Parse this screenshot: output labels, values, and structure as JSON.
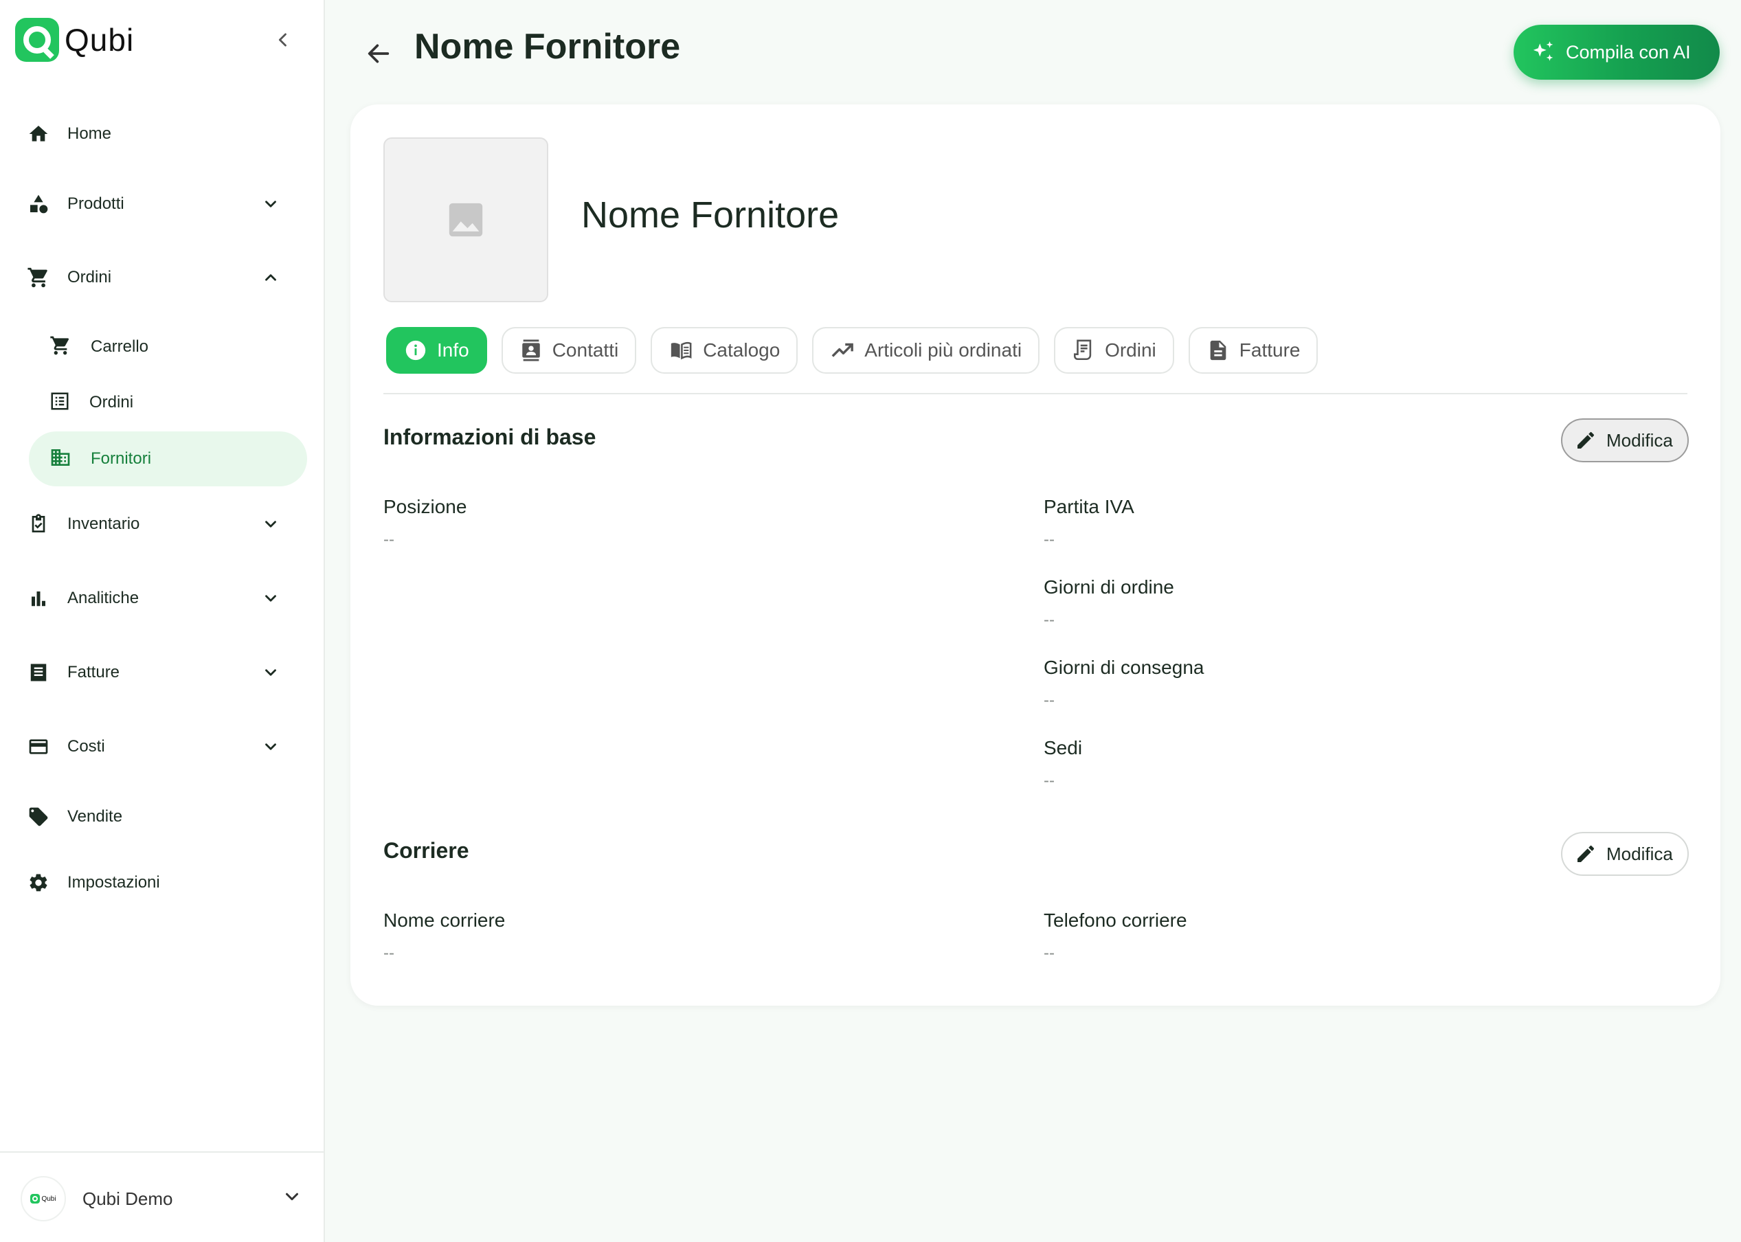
{
  "brand": {
    "name": "Qubi",
    "accent": "#22c55e"
  },
  "sidebar": {
    "items": [
      {
        "label": "Home",
        "icon": "home-icon"
      },
      {
        "label": "Prodotti",
        "icon": "shapes-icon"
      },
      {
        "label": "Ordini",
        "icon": "cart-icon"
      },
      {
        "label": "Inventario",
        "icon": "clipboard-check-icon"
      },
      {
        "label": "Analitiche",
        "icon": "bar-chart-icon"
      },
      {
        "label": "Fatture",
        "icon": "receipt-icon"
      },
      {
        "label": "Costi",
        "icon": "credit-card-icon"
      },
      {
        "label": "Vendite",
        "icon": "tag-icon"
      },
      {
        "label": "Impostazioni",
        "icon": "gear-icon"
      }
    ],
    "ordini_sub": [
      {
        "label": "Carrello",
        "icon": "cart-icon"
      },
      {
        "label": "Ordini",
        "icon": "list-icon"
      },
      {
        "label": "Fornitori",
        "icon": "building-icon",
        "active": true
      }
    ],
    "workspace": {
      "name": "Qubi Demo",
      "logo_text": "Qubi"
    }
  },
  "header": {
    "title": "Nome Fornitore",
    "ai_button": "Compila con AI"
  },
  "supplier": {
    "name": "Nome Fornitore"
  },
  "tabs": [
    {
      "label": "Info",
      "icon": "info-icon",
      "active": true
    },
    {
      "label": "Contatti",
      "icon": "contact-icon"
    },
    {
      "label": "Catalogo",
      "icon": "book-icon"
    },
    {
      "label": "Articoli più ordinati",
      "icon": "trending-up-icon"
    },
    {
      "label": "Ordini",
      "icon": "receipt-long-icon"
    },
    {
      "label": "Fatture",
      "icon": "document-icon"
    }
  ],
  "sections": {
    "base": {
      "title": "Informazioni di base",
      "edit": "Modifica",
      "fields": {
        "posizione": {
          "label": "Posizione",
          "value": "--"
        },
        "partita_iva": {
          "label": "Partita IVA",
          "value": "--"
        },
        "giorni_ordine": {
          "label": "Giorni di ordine",
          "value": "--"
        },
        "giorni_consegna": {
          "label": "Giorni di consegna",
          "value": "--"
        },
        "sedi": {
          "label": "Sedi",
          "value": "--"
        }
      }
    },
    "corriere": {
      "title": "Corriere",
      "edit": "Modifica",
      "fields": {
        "nome": {
          "label": "Nome corriere",
          "value": "--"
        },
        "telefono": {
          "label": "Telefono corriere",
          "value": "--"
        }
      }
    }
  }
}
